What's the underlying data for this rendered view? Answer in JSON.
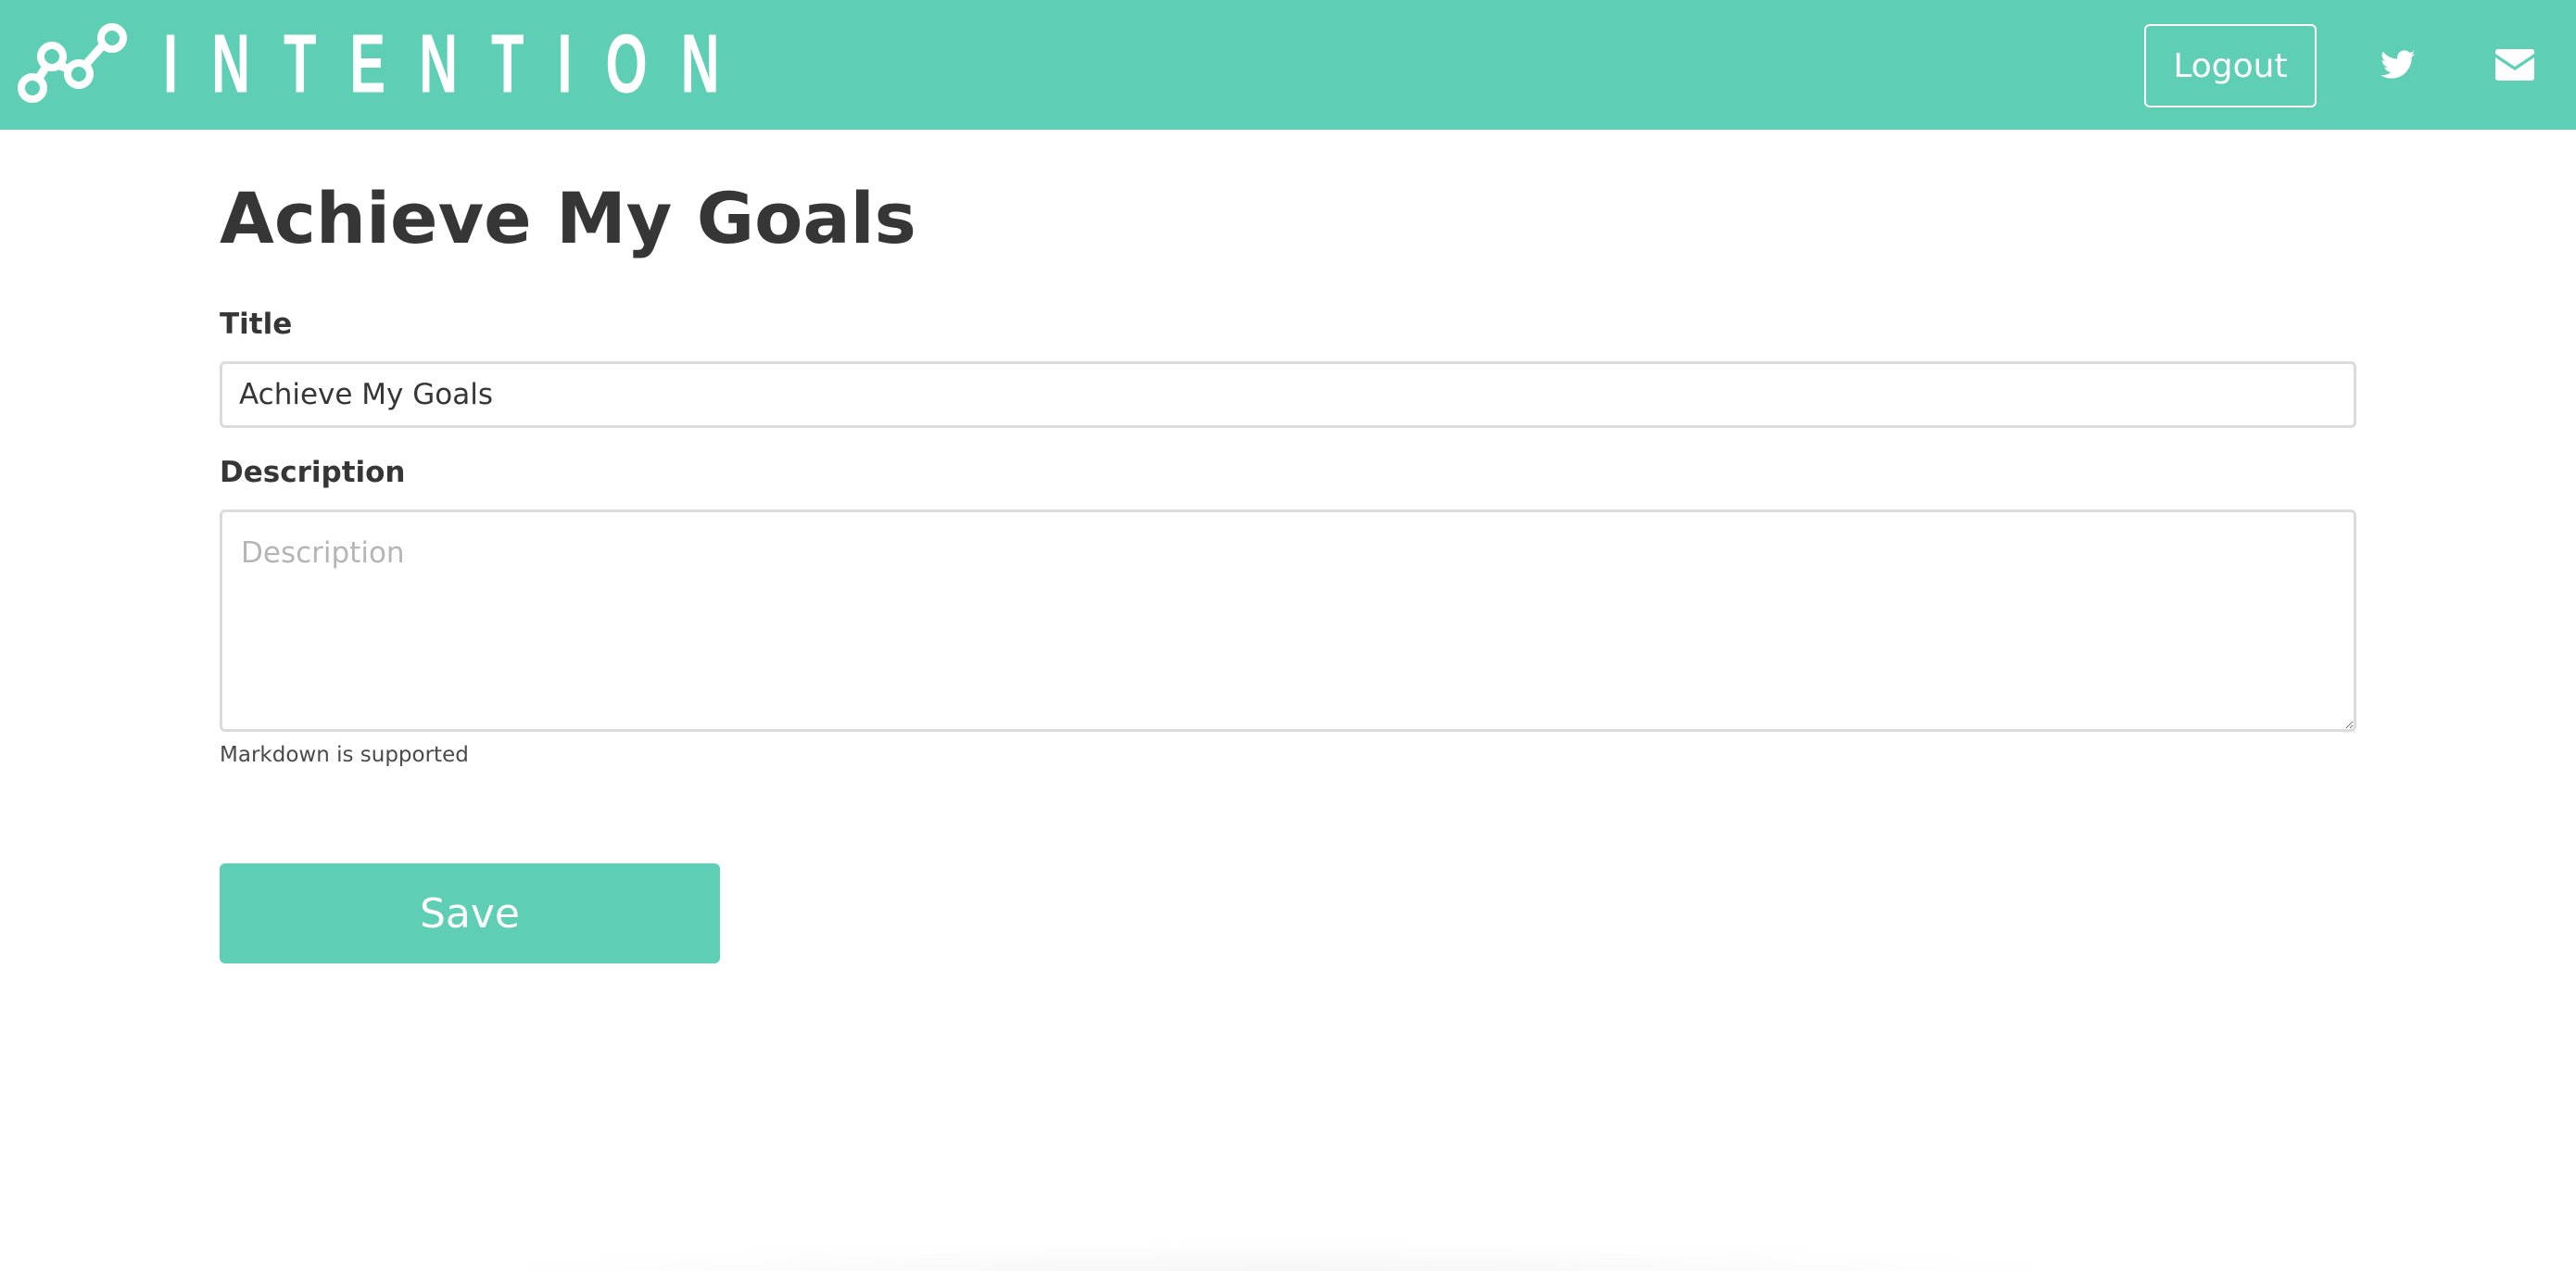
{
  "colors": {
    "brand": "#5ecfb4",
    "text": "#363636",
    "border": "#dbdbdb",
    "placeholder": "#b5b5b5",
    "white": "#ffffff"
  },
  "navbar": {
    "brand_name": "INTENTION",
    "logo_icon": "node-graph-icon",
    "logout_label": "Logout",
    "icons": [
      "twitter-icon",
      "envelope-icon"
    ]
  },
  "page": {
    "title": "Achieve My Goals"
  },
  "form": {
    "title_label": "Title",
    "title_value": "Achieve My Goals",
    "description_label": "Description",
    "description_placeholder": "Description",
    "description_value": "",
    "description_help": "Markdown is supported",
    "save_label": "Save"
  }
}
